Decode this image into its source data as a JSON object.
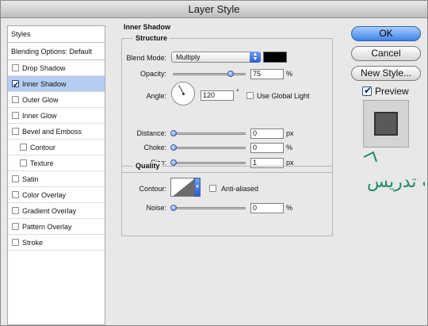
{
  "window": {
    "title": "Layer Style"
  },
  "sidebar": {
    "header": "Styles",
    "blending_options": "Blending Options: Default",
    "items": [
      {
        "label": "Drop Shadow",
        "checked": false,
        "selected": false
      },
      {
        "label": "Inner Shadow",
        "checked": true,
        "selected": true
      },
      {
        "label": "Outer Glow",
        "checked": false,
        "selected": false
      },
      {
        "label": "Inner Glow",
        "checked": false,
        "selected": false
      },
      {
        "label": "Bevel and Emboss",
        "checked": false,
        "selected": false
      },
      {
        "label": "Contour",
        "checked": false,
        "selected": false
      },
      {
        "label": "Texture",
        "checked": false,
        "selected": false
      },
      {
        "label": "Satin",
        "checked": false,
        "selected": false
      },
      {
        "label": "Color Overlay",
        "checked": false,
        "selected": false
      },
      {
        "label": "Gradient Overlay",
        "checked": false,
        "selected": false
      },
      {
        "label": "Pattern Overlay",
        "checked": false,
        "selected": false
      },
      {
        "label": "Stroke",
        "checked": false,
        "selected": false
      }
    ]
  },
  "panel": {
    "title": "Inner Shadow",
    "structure": {
      "title": "Structure",
      "blend_mode_label": "Blend Mode:",
      "blend_mode_value": "Multiply",
      "shadow_color": "#000000",
      "opacity_label": "Opacity:",
      "opacity_value": "75",
      "opacity_unit": "%",
      "angle_label": "Angle:",
      "angle_value": "120",
      "angle_unit": "°",
      "use_global_light_label": "Use Global Light",
      "use_global_light": false,
      "distance_label": "Distance:",
      "distance_value": "0",
      "distance_unit": "px",
      "choke_label": "Choke:",
      "choke_value": "0",
      "choke_unit": "%",
      "size_label": "Size:",
      "size_value": "1",
      "size_unit": "px"
    },
    "quality": {
      "title": "Quality",
      "contour_label": "Contour:",
      "anti_aliased_label": "Anti-aliased",
      "anti_aliased": false,
      "noise_label": "Noise:",
      "noise_value": "0",
      "noise_unit": "%"
    }
  },
  "buttons": {
    "ok": "OK",
    "cancel": "Cancel",
    "new_style": "New Style..."
  },
  "preview": {
    "label": "Preview",
    "checked": true
  },
  "watermark": {
    "text": "وب تدریس"
  },
  "colors": {
    "accent": "#3f83e8",
    "selection": "#b6cdf3",
    "watermark": "#1f8a6a"
  }
}
